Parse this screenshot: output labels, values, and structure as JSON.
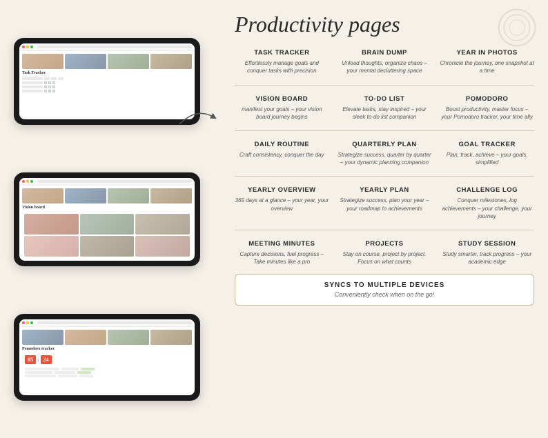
{
  "page": {
    "title": "Productivity pages",
    "background": "#f5f0e8"
  },
  "tablets": [
    {
      "id": "tablet-task-tracker",
      "label": "Task Tracker"
    },
    {
      "id": "tablet-vision-board",
      "label": "Vision board"
    },
    {
      "id": "tablet-pomodoro",
      "label": "Pomodoro tracker"
    }
  ],
  "timer": {
    "minutes": "05",
    "seconds": "24"
  },
  "features": [
    {
      "name": "TASK TRACKER",
      "desc": "Effortlessly manage goals and conquer tasks with precision"
    },
    {
      "name": "BRAIN DUMP",
      "desc": "Unload thoughts, organize chaos – your mental decluttering space"
    },
    {
      "name": "YEAR IN PHOTOS",
      "desc": "Chronicle the journey, one snapshot at a time"
    },
    {
      "name": "VISION BOARD",
      "desc": "manifest your goals – your vision board journey begins"
    },
    {
      "name": "TO-DO LIST",
      "desc": "Elevate tasks, stay inspired – your sleek to-do list companion"
    },
    {
      "name": "POMODORO",
      "desc": "Boost productivity, master focus – your Pomodoro tracker, your time ally"
    },
    {
      "name": "DAILY ROUTINE",
      "desc": "Craft consistency, conquer the day"
    },
    {
      "name": "QUARTERLY PLAN",
      "desc": "Strategize success, quarter by quarter – your dynamic planning companion"
    },
    {
      "name": "GOAL TRACKER",
      "desc": "Plan, track, achieve – your goals, simplified"
    },
    {
      "name": "YEARLY OVERVIEW",
      "desc": "365 days at a glance – your year, your overview"
    },
    {
      "name": "YEARLY PLAN",
      "desc": "Strategize success, plan your year – your roadmap to achievements"
    },
    {
      "name": "CHALLENGE LOG",
      "desc": "Conquer milestones, log achievements – your challenge, your journey"
    },
    {
      "name": "MEETING MINUTES",
      "desc": "Capture decisions, fuel progress – Take minutes like a pro"
    },
    {
      "name": "PROJECTS",
      "desc": "Stay on course, project by project. Focus on what counts"
    },
    {
      "name": "STUDY SESSION",
      "desc": "Study smarter, track progress – your academic edge"
    }
  ],
  "sync": {
    "title": "SYNCS TO MULTIPLE DEVICES",
    "desc": "Conveniently check when on the go!"
  }
}
